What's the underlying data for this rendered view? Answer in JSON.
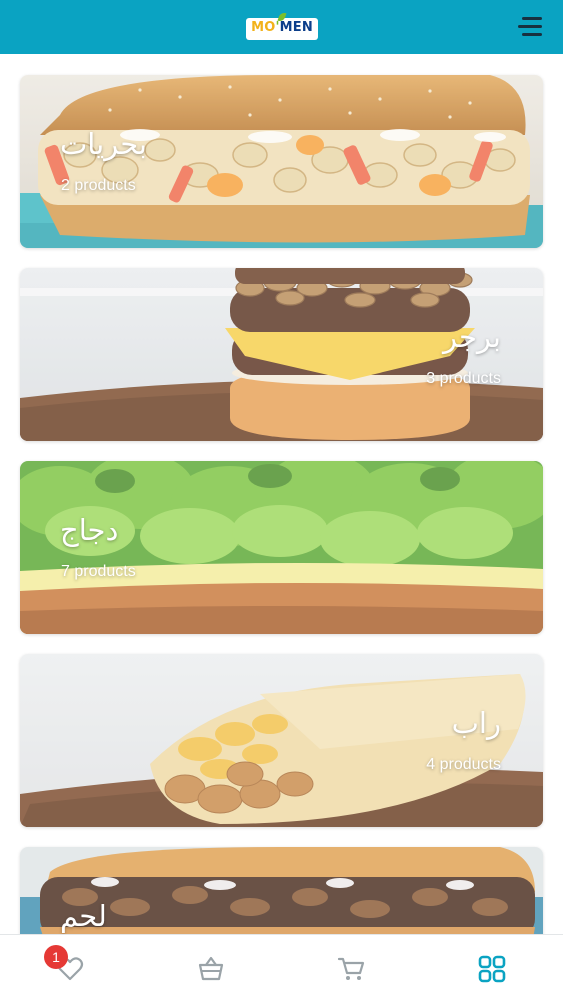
{
  "header": {
    "logo": {
      "mo": "MO",
      "apos": "'",
      "men": "MEN"
    },
    "menu_icon": "hamburger-menu-icon"
  },
  "categories": [
    {
      "name": "بحريات",
      "count": "2 products"
    },
    {
      "name": "برجر",
      "count": "3 products"
    },
    {
      "name": "دجاج",
      "count": "7 products"
    },
    {
      "name": "راب",
      "count": "4 products"
    },
    {
      "name": "لحم",
      "count": ""
    }
  ],
  "bottom_nav": {
    "items": [
      "heart-icon",
      "basket-icon",
      "cart-icon",
      "grid-icon"
    ],
    "favorites_badge": "1",
    "active_item": "grid-icon"
  },
  "colors": {
    "header_bg": "#0aa3c2",
    "active_icon": "#0aa3c2",
    "inactive_icon": "#9aa3a8",
    "badge": "#e53935"
  }
}
